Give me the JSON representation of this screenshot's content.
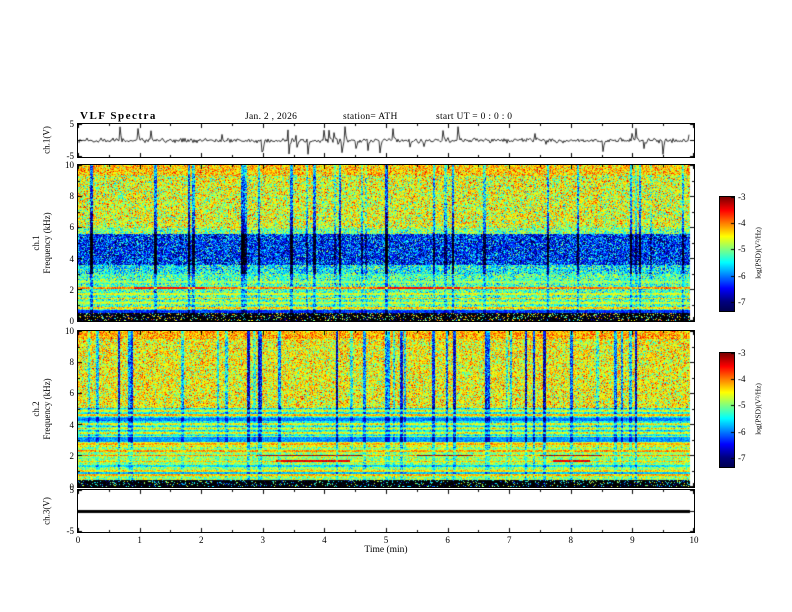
{
  "header": {
    "title": "VLF Spectra",
    "date": "Jan. 2 , 2026",
    "station": "station= ATH",
    "start_ut": "start UT =  0 : 0 : 0"
  },
  "xaxis": {
    "label": "Time (min)",
    "ticks": [
      "0",
      "1",
      "2",
      "3",
      "4",
      "5",
      "6",
      "7",
      "8",
      "9",
      "10"
    ],
    "range": [
      0,
      10
    ]
  },
  "panels": {
    "ch1_wave": {
      "ylabel": "ch.1(V)",
      "yticks": [
        "5",
        "-5"
      ],
      "ylim": [
        -5,
        5
      ]
    },
    "spec1": {
      "ylabel_channel": "ch.1",
      "ylabel_axis": "Frequency (kHz)",
      "yticks": [
        "10",
        "8",
        "6",
        "4",
        "2",
        "0"
      ],
      "ylim": [
        0,
        10
      ]
    },
    "spec2": {
      "ylabel_channel": "ch.2",
      "ylabel_axis": "Frequency (kHz)",
      "yticks": [
        "10",
        "8",
        "6",
        "4",
        "2",
        "0"
      ],
      "ylim": [
        0,
        10
      ]
    },
    "ch3_wave": {
      "ylabel": "ch.3(V)",
      "yticks": [
        "5",
        "-5"
      ],
      "ylim": [
        -5,
        5
      ]
    }
  },
  "colorbar": {
    "label": "log(PSD)(V²/Hz)",
    "ticks": [
      "-3",
      "-4",
      "-5",
      "-6",
      "-7"
    ],
    "range": [
      -3,
      -7
    ]
  },
  "chart_data": [
    {
      "type": "line",
      "name": "ch.1 time series",
      "ylabel": "ch.1(V)",
      "xlabel": "Time (min)",
      "xlim": [
        0,
        10
      ],
      "ylim": [
        -5,
        5
      ],
      "description": "Broadband noisy voltage trace centred on 0 V with frequent impulsive sferic spikes reaching about ±4 V over the full 10-minute record."
    },
    {
      "type": "heatmap",
      "name": "ch.1 spectrogram",
      "xlabel": "Time (min)",
      "ylabel": "Frequency (kHz)",
      "xlim": [
        0,
        10
      ],
      "ylim": [
        0,
        10
      ],
      "zlabel": "log(PSD)(V²/Hz)",
      "zlim": [
        -7,
        -3
      ],
      "colormap": "jet",
      "bands": [
        {
          "f": [
            9.4,
            10
          ],
          "level": -4.35,
          "sigma": 0.4,
          "note": "yellow-speckled top edge"
        },
        {
          "f": [
            6,
            9.4
          ],
          "level": -4.65,
          "sigma": 0.5,
          "note": "green background with yellow speckles"
        },
        {
          "f": [
            5.6,
            6
          ],
          "level": -5.0,
          "sigma": 0.45
        },
        {
          "f": [
            3.6,
            5.6
          ],
          "level": -6.35,
          "sigma": 0.6,
          "note": "dark blue low-power band"
        },
        {
          "f": [
            3.0,
            3.6
          ],
          "level": -5.5,
          "sigma": 0.5
        },
        {
          "f": [
            0.5,
            3.0
          ],
          "level": -5.2,
          "sigma": 0.45,
          "note": "cyan band with narrow horizontal emission lines"
        },
        {
          "f": [
            0,
            0.5
          ],
          "level": -8.2,
          "sigma": 0.7,
          "note": "near-black bottom band with coloured speckles"
        }
      ],
      "lines": [
        {
          "f": 2.08,
          "level": -4.0
        },
        {
          "f": 1.72,
          "level": -4.6
        },
        {
          "f": 1.42,
          "level": -4.35
        },
        {
          "f": 1.12,
          "level": -4.7
        },
        {
          "f": 0.82,
          "level": -4.3
        },
        {
          "f": 2.5,
          "level": -4.9
        }
      ],
      "hot_segments": [
        {
          "f": 2.08,
          "level": -3.55,
          "t": [
            [
              0.9,
              2.05
            ],
            [
              4.85,
              6.2
            ]
          ]
        }
      ],
      "dropouts": "frequent 1-3 px wide vertical dark-blue stripes across all frequencies"
    },
    {
      "type": "heatmap",
      "name": "ch.2 spectrogram",
      "xlabel": "Time (min)",
      "ylabel": "Frequency (kHz)",
      "xlim": [
        0,
        10
      ],
      "ylim": [
        0,
        10
      ],
      "zlabel": "log(PSD)(V²/Hz)",
      "zlim": [
        -7,
        -3
      ],
      "colormap": "jet",
      "bands": [
        {
          "f": [
            9.5,
            10
          ],
          "level": -4.2,
          "sigma": 0.35,
          "note": "yellow-green top strip"
        },
        {
          "f": [
            5.05,
            9.5
          ],
          "level": -4.55,
          "sigma": 0.45,
          "note": "green background with cyan dropout streaks"
        },
        {
          "f": [
            2.55,
            5.05
          ],
          "level": -5.0,
          "sigma": 0.3,
          "striped": true,
          "note": "fine horizontal green/cyan striping"
        },
        {
          "f": [
            0.45,
            2.55
          ],
          "level": -4.9,
          "sigma": 0.35,
          "note": "banded region with emission lines"
        },
        {
          "f": [
            0,
            0.45
          ],
          "level": -8.5,
          "sigma": 0.7,
          "note": "black bottom band"
        }
      ],
      "lines": [
        {
          "f": 4.63,
          "level": -4.2
        },
        {
          "f": 2.72,
          "level": -4.2
        },
        {
          "f": 2.3,
          "level": -4.1
        },
        {
          "f": 2.0,
          "level": -4.05
        },
        {
          "f": 1.62,
          "level": -4.3
        },
        {
          "f": 1.3,
          "level": -5.6
        },
        {
          "f": 1.02,
          "level": -4.35
        },
        {
          "f": 0.72,
          "level": -4.2
        }
      ],
      "hot_segments": [
        {
          "f": 2.0,
          "level": -3.15,
          "t": [
            [
              2.9,
              4.6
            ],
            [
              5.5,
              6.4
            ],
            [
              7.5,
              8.5
            ]
          ]
        },
        {
          "f": 1.62,
          "level": -3.4,
          "t": [
            [
              3.2,
              4.4
            ],
            [
              7.7,
              8.3
            ]
          ]
        }
      ],
      "dropouts": "vertical cyan/blue stripes mainly above 5 kHz"
    },
    {
      "type": "line",
      "name": "ch.3 time series",
      "ylabel": "ch.3(V)",
      "xlim": [
        0,
        10
      ],
      "ylim": [
        -5,
        5
      ],
      "value": 0,
      "description": "Constant thick black line at 0 V for the whole record (flat channel)."
    }
  ]
}
